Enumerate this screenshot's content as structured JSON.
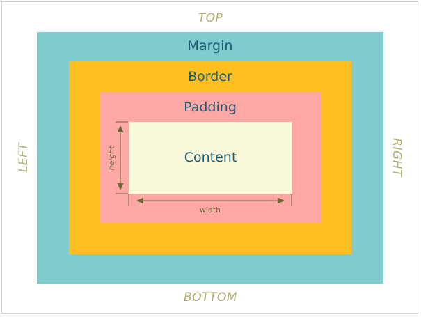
{
  "sides": {
    "top": "TOP",
    "bottom": "BOTTOM",
    "left": "LEFT",
    "right": "RIGHT"
  },
  "boxes": {
    "margin": "Margin",
    "border": "Border",
    "padding": "Padding",
    "content": "Content"
  },
  "dimensions": {
    "width": "width",
    "height": "height"
  },
  "colors": {
    "margin": "#80cbcd",
    "border": "#fdbf22",
    "padding": "#fea8a6",
    "content": "#f9f8da",
    "side_label": "#b1ad6f",
    "box_label": "#1c5c74",
    "dimension": "#6b6833"
  }
}
